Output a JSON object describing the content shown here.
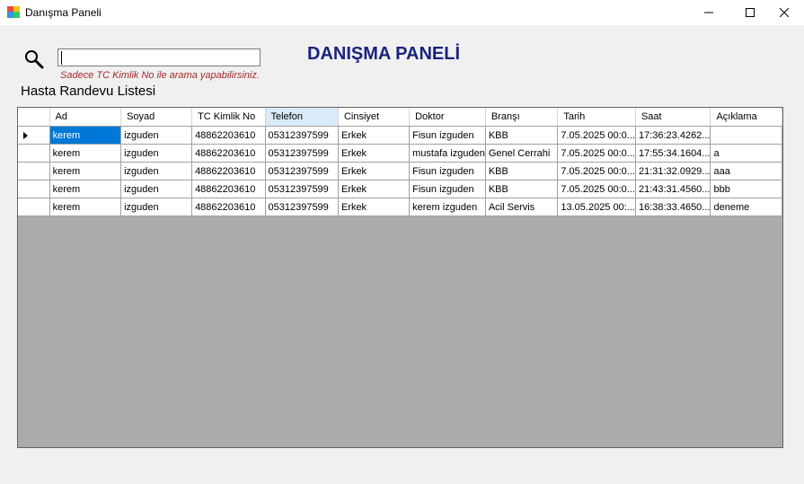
{
  "window": {
    "title": "Danışma Paneli"
  },
  "search": {
    "value": "",
    "hint": "Sadece TC Kimlik No ile arama yapabilirsiniz."
  },
  "page": {
    "title": "DANIŞMA PANELİ",
    "list_title": "Hasta Randevu Listesi"
  },
  "icons": {
    "search": "search-icon",
    "app": "app-icon",
    "minimize": "minimize-icon",
    "maximize": "maximize-icon",
    "close": "close-icon"
  },
  "grid": {
    "columns": [
      "Ad",
      "Soyad",
      "TC Kimlik No",
      "Telefon",
      "Cinsiyet",
      "Doktor",
      "Branşı",
      "Tarih",
      "Saat",
      "Açıklama"
    ],
    "rows": [
      [
        "kerem",
        "izguden",
        "48862203610",
        "05312397599",
        "Erkek",
        "Fisun izguden",
        "KBB",
        "7.05.2025 00:0...",
        "17:36:23.4262...",
        ""
      ],
      [
        "kerem",
        "izguden",
        "48862203610",
        "05312397599",
        "Erkek",
        "mustafa izguden",
        "Genel Cerrahi",
        "7.05.2025 00:0...",
        "17:55:34.1604...",
        "a"
      ],
      [
        "kerem",
        "izguden",
        "48862203610",
        "05312397599",
        "Erkek",
        "Fisun izguden",
        "KBB",
        "7.05.2025 00:0...",
        "21:31:32.0929...",
        "aaa"
      ],
      [
        "kerem",
        "izguden",
        "48862203610",
        "05312397599",
        "Erkek",
        "Fisun izguden",
        "KBB",
        "7.05.2025 00:0...",
        "21:43:31.4560...",
        "bbb"
      ],
      [
        "kerem",
        "izguden",
        "48862203610",
        "05312397599",
        "Erkek",
        "kerem izguden",
        "Acil Servis",
        "13.05.2025 00:...",
        "16:38:33.4650...",
        "deneme"
      ]
    ]
  },
  "colors": {
    "title": "#1a237e",
    "hint": "#a52a2a",
    "selection": "#0078d7",
    "grid_background": "#ababab",
    "selected_header": "#d9ebf9"
  }
}
